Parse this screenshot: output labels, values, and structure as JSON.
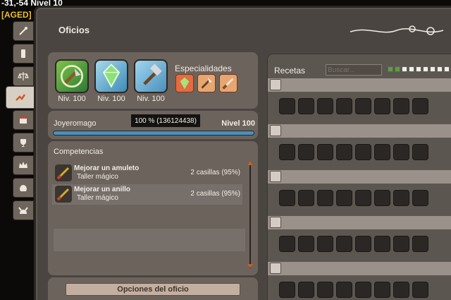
{
  "hud": {
    "coordinates": "-31,-54",
    "level_label": "Nivel 10",
    "guild_tag": "[AGED]"
  },
  "sidebar": {
    "tabs": [
      {
        "name": "quests-tab",
        "icon": "wand-icon"
      },
      {
        "name": "phone-tab",
        "icon": "phone-icon"
      },
      {
        "name": "justice-tab",
        "icon": "scales-icon"
      },
      {
        "name": "jobs-tab",
        "icon": "crafting-icon",
        "active": true
      },
      {
        "name": "calendar-tab",
        "icon": "calendar-icon"
      },
      {
        "name": "trophy-tab",
        "icon": "trophy-icon"
      },
      {
        "name": "guild-tab",
        "icon": "crown-icon"
      },
      {
        "name": "alliance-tab",
        "icon": "helmet-icon"
      },
      {
        "name": "creature-tab",
        "icon": "horned-helmet-icon"
      }
    ]
  },
  "window": {
    "title": "Oficios",
    "jobs": [
      {
        "name": "job-lumberjack",
        "icon": "axe-icon",
        "level": "Niv. 100"
      },
      {
        "name": "job-jeweler",
        "icon": "gem-icon",
        "level": "Niv. 100"
      },
      {
        "name": "job-smith",
        "icon": "hammer-icon",
        "level": "Niv. 100"
      }
    ],
    "specialties_title": "Especialidades",
    "specialties": [
      {
        "name": "spec-gem",
        "icon": "gem-spec-icon"
      },
      {
        "name": "spec-axe",
        "icon": "axe-spec-icon"
      },
      {
        "name": "spec-dagger",
        "icon": "dagger-spec-icon"
      }
    ],
    "experience": {
      "job_name": "Joyeromago",
      "tooltip": "100 % (136124438)",
      "level": "Nivel 100",
      "progress": 1.0
    },
    "skills": {
      "title": "Competencias",
      "items": [
        {
          "name": "Mejorar un amuleto",
          "workshop": "Taller mágico",
          "cost": "2 casillas (95%)"
        },
        {
          "name": "Mejorar un anillo",
          "workshop": "Taller mágico",
          "cost": "2 casillas (95%)"
        }
      ]
    },
    "options_button": "Opciones del oficio",
    "recipes": {
      "label": "Recetas",
      "search_placeholder": "Buscar...",
      "filters": [
        true,
        true,
        false,
        false,
        false,
        false,
        false,
        false,
        false,
        false,
        false
      ],
      "groups": 5,
      "slots_per_group": 8
    }
  },
  "colors": {
    "panel": "#6b635c",
    "accent": "#c85e28",
    "xp_fill": "#4d8fba"
  }
}
